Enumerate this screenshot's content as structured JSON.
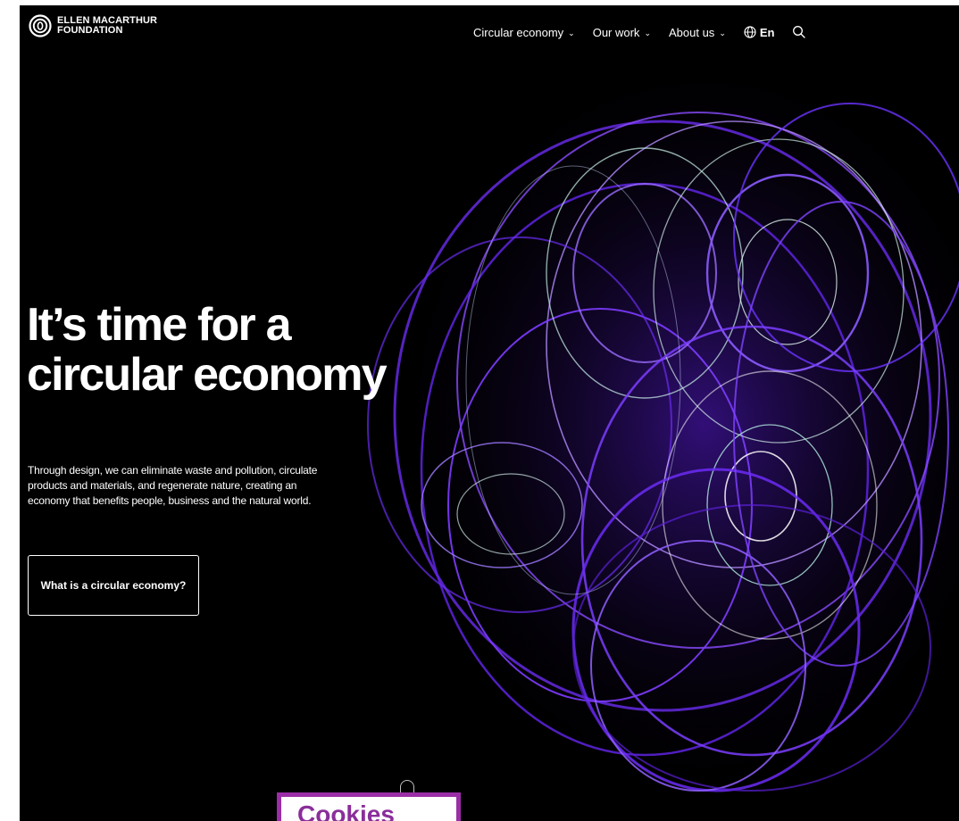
{
  "header": {
    "logo_line1": "ELLEN MACARTHUR",
    "logo_line2": "FOUNDATION",
    "logo_icon": "emf-ring-logo-icon",
    "nav": [
      {
        "label": "Circular economy",
        "chevron": "⌄"
      },
      {
        "label": "Our work",
        "chevron": "⌄"
      },
      {
        "label": "About us",
        "chevron": "⌄"
      }
    ],
    "language_label": "En",
    "language_icon": "globe-icon",
    "search_icon": "search-icon"
  },
  "hero": {
    "headline": "It’s time for a circular economy",
    "body": "Through design, we can eliminate waste and pollution, circulate products and materials, and regenerate nature, creating an economy that benefits people, business and the natural world.",
    "cta_label": "What is a circular economy?",
    "background": "purple light-trail swirls"
  },
  "popup": {
    "label": "Cookies"
  },
  "colors": {
    "background": "#000000",
    "text": "#ffffff",
    "accent_purple": "#7b2cff",
    "popup_border": "#9b2ea6"
  }
}
